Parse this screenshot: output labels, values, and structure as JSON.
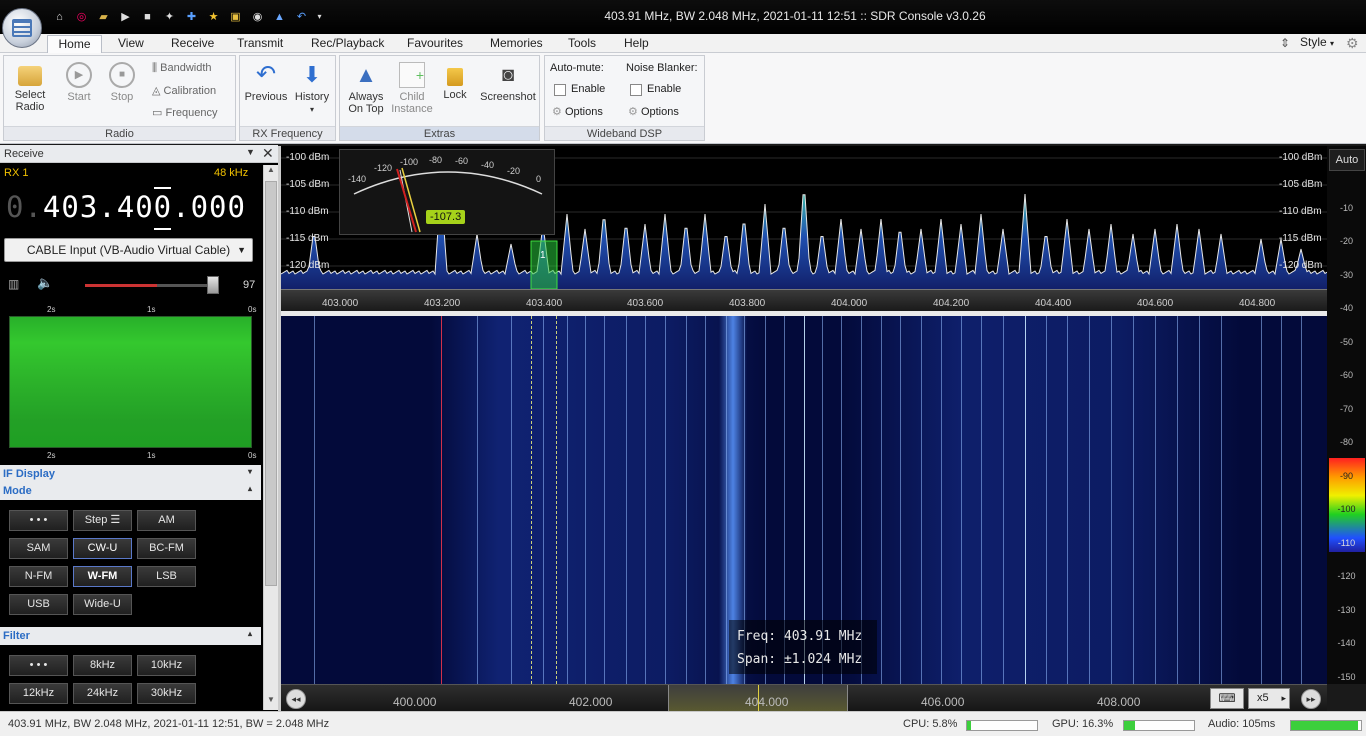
{
  "window": {
    "title": "403.91 MHz, BW 2.048 MHz, 2021-01-11 12:51 :: SDR Console v3.0.26"
  },
  "quick_access": [
    "home-icon",
    "lifebuoy-icon",
    "folder-icon",
    "play-icon",
    "stop-icon",
    "satellite-icon",
    "plus-icon",
    "star-icon",
    "lock-icon",
    "camera-icon",
    "antenna-icon",
    "undo-icon"
  ],
  "tabs": [
    "Home",
    "View",
    "Receive",
    "Transmit",
    "Rec/Playback",
    "Favourites",
    "Memories",
    "Tools",
    "Help"
  ],
  "style_label": "Style",
  "ribbon": {
    "radio": {
      "label": "Radio",
      "select": "Select\nRadio",
      "start": "Start",
      "stop": "Stop",
      "bandwidth": "Bandwidth",
      "calibration": "Calibration",
      "frequency": "Frequency"
    },
    "rxfreq": {
      "label": "RX Frequency",
      "previous": "Previous",
      "history": "History"
    },
    "extras": {
      "label": "Extras",
      "always_on_top": "Always\nOn Top",
      "child_instance": "Child\nInstance",
      "lock": "Lock",
      "screenshot": "Screenshot"
    },
    "dsp": {
      "label": "Wideband DSP",
      "automute": "Auto-mute:",
      "noise_blanker": "Noise Blanker:",
      "enable1": "Enable",
      "enable2": "Enable",
      "options1": "Options",
      "options2": "Options"
    }
  },
  "left": {
    "header": "Receive",
    "rx": "RX 1",
    "bw": "48 kHz",
    "freq_dim": "0.",
    "freq": "403.400.000",
    "device": "CABLE Input (VB-Audio Virtual Cable)",
    "volume": "97",
    "volume_level": 0.55,
    "spectro_top": [
      "2s",
      "1s",
      "0s"
    ],
    "spectro_bottom": [
      "2s",
      "1s",
      "0s"
    ],
    "if_display": "IF Display",
    "mode": "Mode",
    "mode_buttons": [
      "• • •",
      "Step ☰",
      "AM",
      "SAM",
      "CW-U",
      "BC-FM",
      "N-FM",
      "W-FM",
      "LSB",
      "USB",
      "Wide-U"
    ],
    "filter": "Filter",
    "filter_buttons": [
      "• • •",
      "8kHz",
      "10kHz",
      "12kHz",
      "24kHz",
      "30kHz"
    ]
  },
  "spectrum": {
    "db_labels": [
      "-100 dBm",
      "-105 dBm",
      "-110 dBm",
      "-115 dBm",
      "-120 dBm"
    ],
    "freq_ticks": [
      "403.000",
      "403.200",
      "403.400",
      "403.600",
      "403.800",
      "404.000",
      "404.200",
      "404.400",
      "404.600",
      "404.800"
    ],
    "meter_scale": [
      "-140",
      "-120",
      "-100",
      "-80",
      "-60",
      "-40",
      "-20",
      "0"
    ],
    "meter_value": "-107.3",
    "marker": "1"
  },
  "right_scale": {
    "auto": "Auto",
    "labels": [
      "-10",
      "-20",
      "-30",
      "-40",
      "-50",
      "-60",
      "-70",
      "-80",
      "-90",
      "-100",
      "-110",
      "-120",
      "-130",
      "-140",
      "-150"
    ]
  },
  "tooltip": {
    "freq": "Freq: 403.91 MHz",
    "span": "Span: ±1.024 MHz"
  },
  "bottom_axis": {
    "ticks": [
      "400.000",
      "402.000",
      "404.000",
      "406.000",
      "408.000"
    ],
    "zoom": "x5"
  },
  "status": {
    "text": "403.91 MHz, BW 2.048 MHz, 2021-01-11 12:51, BW = 2.048 MHz",
    "cpu": "CPU: 5.8%",
    "cpu_level": 0.06,
    "gpu": "GPU: 16.3%",
    "gpu_level": 0.16,
    "audio": "Audio: 105ms",
    "audio_level": 0.95
  }
}
